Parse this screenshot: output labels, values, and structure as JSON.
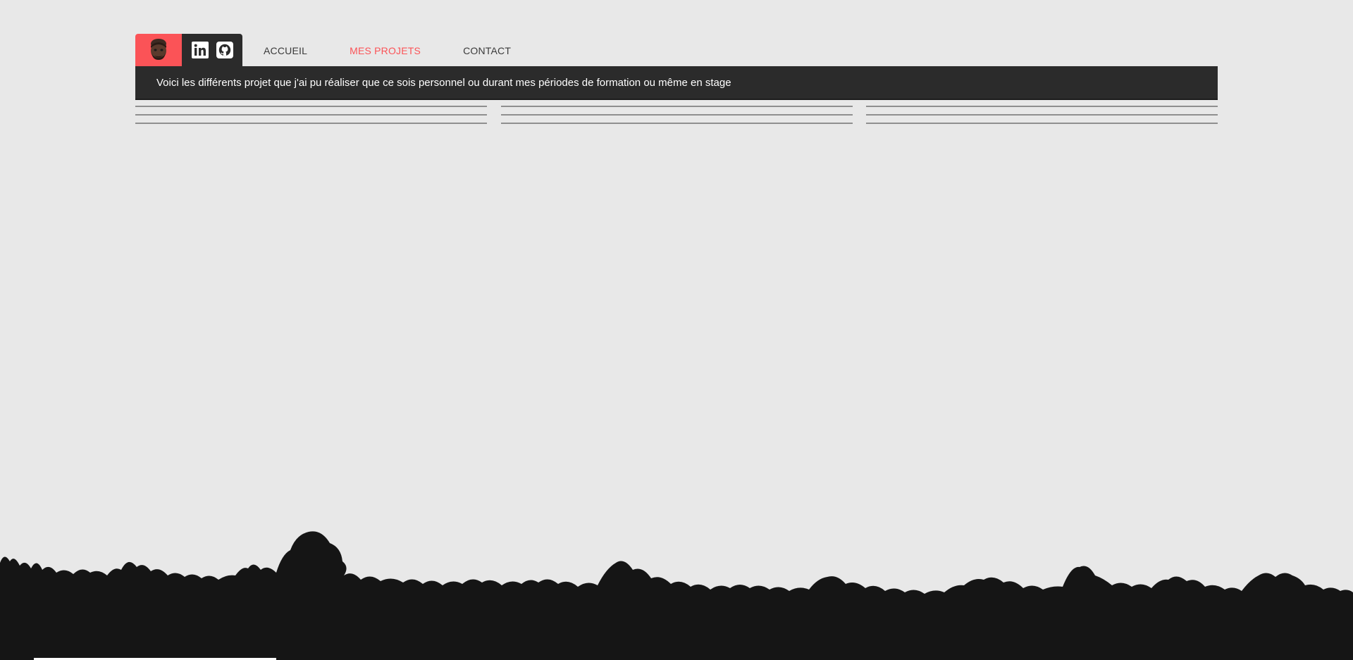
{
  "header": {
    "avatar_icon": "memoji-avatar-icon",
    "socials": [
      {
        "name": "linkedin-icon"
      },
      {
        "name": "github-icon"
      }
    ],
    "nav": [
      {
        "label": "ACCUEIL",
        "active": false
      },
      {
        "label": "MES PROJETS",
        "active": true
      },
      {
        "label": "CONTACT",
        "active": false
      }
    ]
  },
  "intro": {
    "text": "Voici les différents projet que j'ai pu réaliser que ce sois personnel ou durant mes périodes de formation ou même en stage"
  },
  "colors": {
    "accent": "#fb5357",
    "dark": "#2b2b2b",
    "background": "#e8e8e8",
    "silhouette": "#151515"
  }
}
